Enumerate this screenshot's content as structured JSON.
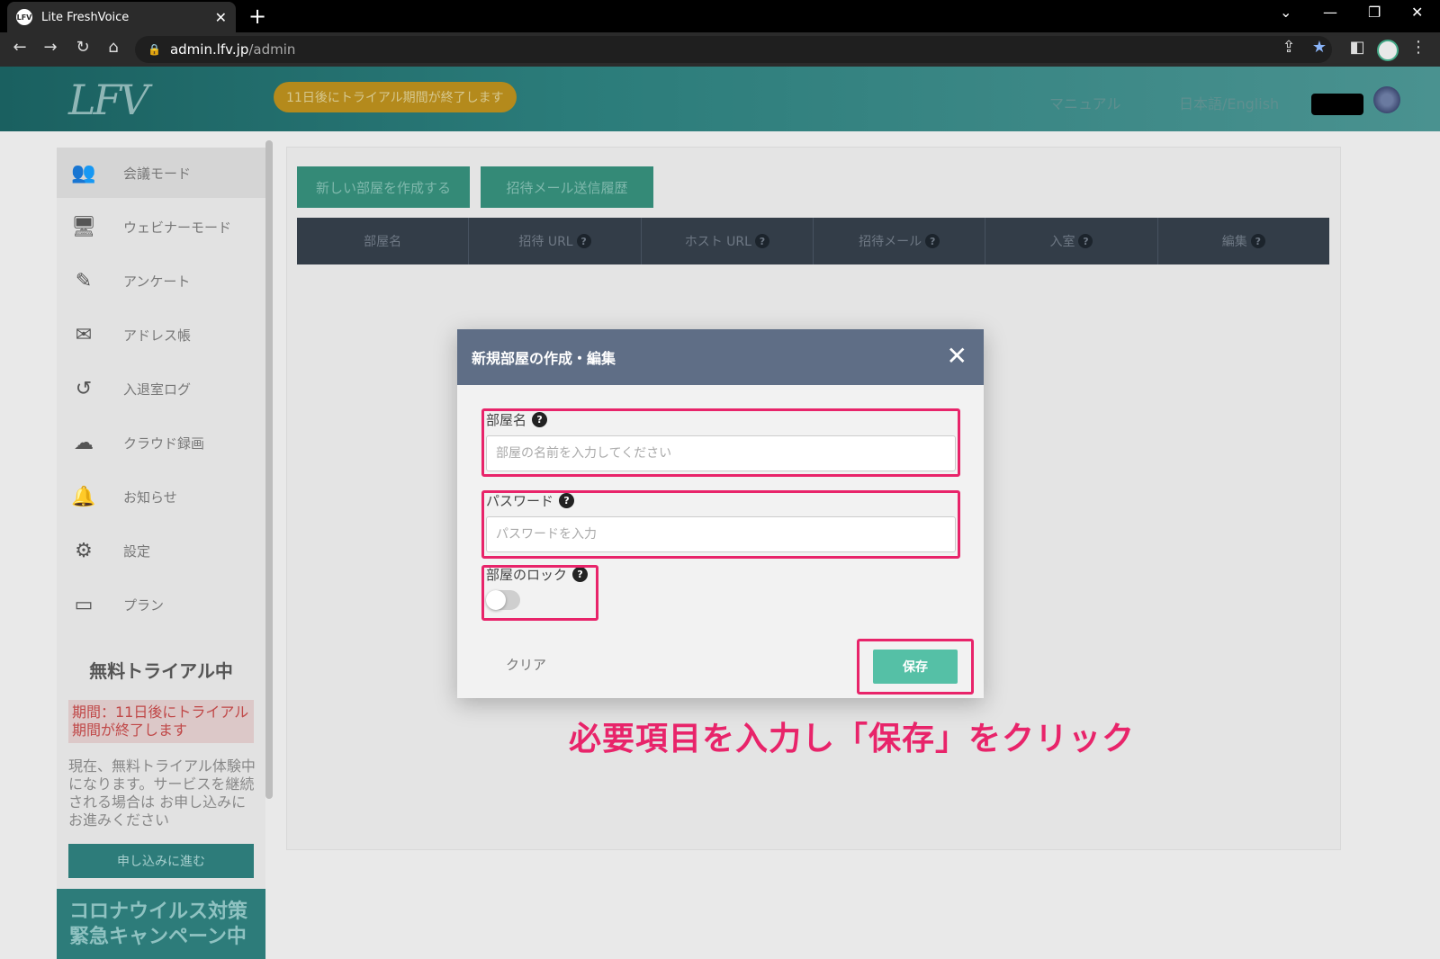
{
  "browser": {
    "tab_title": "Lite FreshVoice",
    "tab_favicon": "LFV",
    "url_host": "admin.lfv.jp",
    "url_path": "/admin"
  },
  "header": {
    "logo": "LFV",
    "trial_banner": "11日後にトライアル期間が終了します",
    "manual": "マニュアル",
    "language": "日本語/English"
  },
  "sidebar": {
    "items": [
      {
        "label": "会議モード",
        "icon": "meeting-icon",
        "glyph": "👥"
      },
      {
        "label": "ウェビナーモード",
        "icon": "webinar-icon",
        "glyph": "🖥"
      },
      {
        "label": "アンケート",
        "icon": "survey-icon",
        "glyph": "✎"
      },
      {
        "label": "アドレス帳",
        "icon": "mail-icon",
        "glyph": "✉"
      },
      {
        "label": "入退室ログ",
        "icon": "history-icon",
        "glyph": "↺"
      },
      {
        "label": "クラウド録画",
        "icon": "cloud-icon",
        "glyph": "☁"
      },
      {
        "label": "お知らせ",
        "icon": "bell-icon",
        "glyph": "🔔"
      },
      {
        "label": "設定",
        "icon": "gear-icon",
        "glyph": "⚙"
      },
      {
        "label": "プラン",
        "icon": "card-icon",
        "glyph": "▭"
      }
    ],
    "trial_title": "無料トライアル中",
    "trial_period": "期間：11日後にトライアル期間が終了します",
    "trial_desc": "現在、無料トライアル体験中 になります。サービスを継続される場合は お申し込みにお進みください",
    "apply_button": "申し込みに進む",
    "campaign_line1": "コロナウイルス対策",
    "campaign_line2": "緊急キャンペーン中"
  },
  "main": {
    "new_room_button": "新しい部屋を作成する",
    "invite_history_button": "招待メール送信履歴",
    "table_headers": [
      {
        "label": "部屋名",
        "help": false
      },
      {
        "label": "招待 URL",
        "help": true
      },
      {
        "label": "ホスト URL",
        "help": true
      },
      {
        "label": "招待メール",
        "help": true
      },
      {
        "label": "入室",
        "help": true
      },
      {
        "label": "編集",
        "help": true
      }
    ],
    "help_glyph": "?"
  },
  "modal": {
    "title": "新規部屋の作成・編集",
    "close_glyph": "✕",
    "room_name_label": "部屋名",
    "room_name_placeholder": "部屋の名前を入力してください",
    "password_label": "パスワード",
    "password_placeholder": "パスワードを入力",
    "lock_label": "部屋のロック",
    "lock_enabled": false,
    "clear_button": "クリア",
    "save_button": "保存"
  },
  "annotation": {
    "instruction": "必要項目を入力し「保存」をクリック",
    "highlight_color": "#e8246a"
  }
}
